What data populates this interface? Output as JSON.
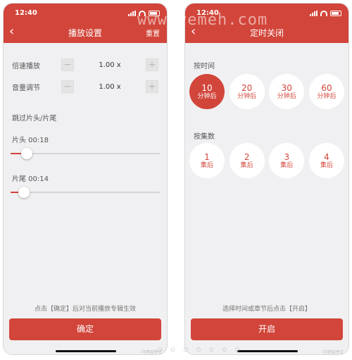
{
  "watermark": "www.yemeh.com",
  "status": {
    "time": "12:40"
  },
  "left": {
    "title": "播放设置",
    "action": "重置",
    "speed": {
      "label": "倍速播放",
      "value": "1.00 x"
    },
    "volume": {
      "label": "音量调节",
      "value": "1.00 x"
    },
    "skip_title": "跳过片头/片尾",
    "intro": {
      "label": "片头 00:18",
      "fraction": 0.11
    },
    "outro": {
      "label": "片尾 00:14",
      "fraction": 0.09
    },
    "hint": "点击【确定】后对当前播放专辑生效",
    "confirm": "确定",
    "credit": "叮咚软件汇"
  },
  "right": {
    "title": "定时关闭",
    "by_time": "按时间",
    "time_options": [
      {
        "num": "10",
        "unit": "分钟后"
      },
      {
        "num": "20",
        "unit": "分钟后"
      },
      {
        "num": "30",
        "unit": "分钟后"
      },
      {
        "num": "60",
        "unit": "分钟后"
      }
    ],
    "by_episode": "按集数",
    "episode_options": [
      {
        "num": "1",
        "unit": "集后"
      },
      {
        "num": "2",
        "unit": "集后"
      },
      {
        "num": "3",
        "unit": "集后"
      },
      {
        "num": "4",
        "unit": "集后"
      }
    ],
    "hint": "选择时间或章节后点击【开启】",
    "start": "开启",
    "credit": "叮咚软件汇"
  },
  "page_dots": "○ ○ ○ ○ ○ ○ ○",
  "colors": {
    "accent": "#d2453a",
    "background": "#f0f0f2"
  },
  "icons": {
    "back": "chevron-left-icon",
    "minus": "minus-icon",
    "plus": "plus-icon"
  }
}
